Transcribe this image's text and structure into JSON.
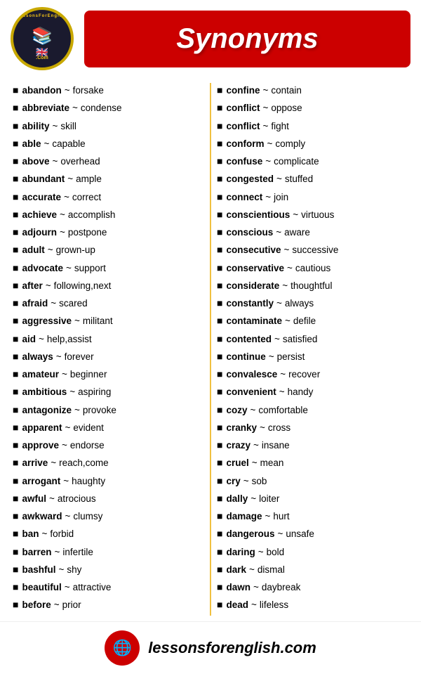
{
  "header": {
    "logo": {
      "text_top": "LessonsForEnglish",
      "text_bottom": ".Com",
      "books_emoji": "📚",
      "flag_emoji": "🇬🇧"
    },
    "title": "Synonyms"
  },
  "footer": {
    "url": "lessonsforenglish.com",
    "globe_icon": "🌐"
  },
  "left_column": [
    {
      "word": "abandon",
      "synonym": "forsake"
    },
    {
      "word": "abbreviate",
      "synonym": "condense"
    },
    {
      "word": "ability",
      "synonym": "skill"
    },
    {
      "word": "able",
      "synonym": "capable"
    },
    {
      "word": "above",
      "synonym": "overhead"
    },
    {
      "word": "abundant",
      "synonym": "ample"
    },
    {
      "word": "accurate",
      "synonym": "correct"
    },
    {
      "word": "achieve",
      "synonym": "accomplish"
    },
    {
      "word": "adjourn",
      "synonym": "postpone"
    },
    {
      "word": "adult",
      "synonym": "grown-up"
    },
    {
      "word": "advocate",
      "synonym": "support"
    },
    {
      "word": "after",
      "synonym": "following,next"
    },
    {
      "word": "afraid",
      "synonym": "scared"
    },
    {
      "word": "aggressive",
      "synonym": "militant"
    },
    {
      "word": "aid",
      "synonym": "help,assist"
    },
    {
      "word": "always",
      "synonym": "forever"
    },
    {
      "word": "amateur",
      "synonym": "beginner"
    },
    {
      "word": "ambitious",
      "synonym": "aspiring"
    },
    {
      "word": "antagonize",
      "synonym": "provoke"
    },
    {
      "word": "apparent",
      "synonym": "evident"
    },
    {
      "word": "approve",
      "synonym": "endorse"
    },
    {
      "word": "arrive",
      "synonym": "reach,come"
    },
    {
      "word": "arrogant",
      "synonym": "haughty"
    },
    {
      "word": "awful",
      "synonym": "atrocious"
    },
    {
      "word": "awkward",
      "synonym": "clumsy"
    },
    {
      "word": "ban",
      "synonym": "forbid"
    },
    {
      "word": "barren",
      "synonym": "infertile"
    },
    {
      "word": "bashful",
      "synonym": "shy"
    },
    {
      "word": "beautiful",
      "synonym": "attractive"
    },
    {
      "word": "before",
      "synonym": "prior"
    }
  ],
  "right_column": [
    {
      "word": "confine",
      "synonym": "contain"
    },
    {
      "word": "conflict",
      "synonym": "oppose"
    },
    {
      "word": "conflict",
      "synonym": "fight"
    },
    {
      "word": "conform",
      "synonym": "comply"
    },
    {
      "word": "confuse",
      "synonym": "complicate"
    },
    {
      "word": "congested",
      "synonym": "stuffed"
    },
    {
      "word": "connect",
      "synonym": "join"
    },
    {
      "word": "conscientious",
      "synonym": "virtuous"
    },
    {
      "word": "conscious",
      "synonym": "aware"
    },
    {
      "word": "consecutive",
      "synonym": "successive"
    },
    {
      "word": "conservative",
      "synonym": "cautious"
    },
    {
      "word": "considerate",
      "synonym": "thoughtful"
    },
    {
      "word": "constantly",
      "synonym": "always"
    },
    {
      "word": "contaminate",
      "synonym": "defile"
    },
    {
      "word": "contented",
      "synonym": "satisfied"
    },
    {
      "word": "continue",
      "synonym": "persist"
    },
    {
      "word": "convalesce",
      "synonym": "recover"
    },
    {
      "word": "convenient",
      "synonym": "handy"
    },
    {
      "word": "cozy",
      "synonym": "comfortable"
    },
    {
      "word": "cranky",
      "synonym": "cross"
    },
    {
      "word": "crazy",
      "synonym": "insane"
    },
    {
      "word": "cruel",
      "synonym": "mean"
    },
    {
      "word": "cry",
      "synonym": "sob"
    },
    {
      "word": "dally",
      "synonym": "loiter"
    },
    {
      "word": "damage",
      "synonym": "hurt"
    },
    {
      "word": "dangerous",
      "synonym": "unsafe"
    },
    {
      "word": "daring",
      "synonym": "bold"
    },
    {
      "word": "dark",
      "synonym": "dismal"
    },
    {
      "word": "dawn",
      "synonym": "daybreak"
    },
    {
      "word": "dead",
      "synonym": "lifeless"
    }
  ]
}
